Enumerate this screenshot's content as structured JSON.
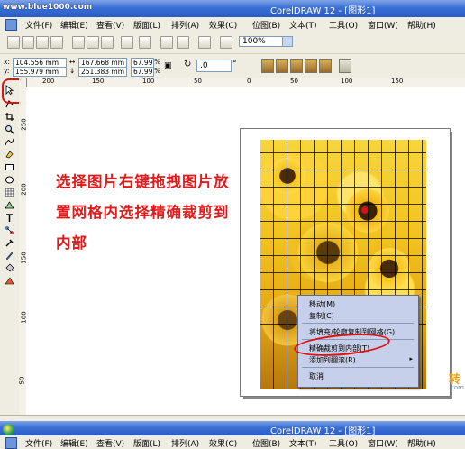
{
  "app": {
    "watermark": "www.blue1000.com",
    "title": "CorelDRAW 12 - [图形1]"
  },
  "menu": [
    "文件(F)",
    "编辑(E)",
    "查看(V)",
    "版面(L)",
    "排列(A)",
    "效果(C)",
    "位图(B)",
    "文本(T)",
    "工具(O)",
    "窗口(W)",
    "帮助(H)"
  ],
  "toolbar": {
    "zoom": "100%",
    "icons": [
      "new-icon",
      "open-icon",
      "save-icon",
      "print-icon",
      "cut-icon",
      "copy-icon",
      "paste-icon",
      "undo-icon",
      "redo-icon",
      "import-icon",
      "export-icon",
      "application-launcher-icon",
      "corel-online-icon"
    ]
  },
  "properties": {
    "x": "104.556 mm",
    "y": "155.979 mm",
    "width": "167.668 mm",
    "height": "251.383 mm",
    "scale_w": "67.99",
    "scale_h": "67.99",
    "percent": "%",
    "rotation": ".0",
    "degree": "°"
  },
  "rulers": {
    "h_labels": [
      "200",
      "150",
      "100",
      "50",
      "0",
      "50",
      "100",
      "150"
    ],
    "v_labels": [
      "250",
      "200",
      "150",
      "100",
      "50"
    ]
  },
  "instruction": {
    "line1": "选择图片右键拖拽图片放",
    "line2": "置网格内选择精确裁剪到",
    "line3": "内部"
  },
  "context_menu": {
    "items": [
      {
        "label": "移动(M)"
      },
      {
        "label": "复制(C)"
      },
      {
        "label": "将填充/轮廓复制到网格(G)"
      },
      {
        "label": "精确裁剪到内部(T)"
      },
      {
        "label": "添加到翻滚(R)"
      },
      {
        "label": "取消"
      }
    ],
    "submenu_arrow": "▸"
  },
  "logo": {
    "line1": "转",
    "line2": "com"
  },
  "colors": {
    "title_blue": "#3a6fd6",
    "menu_bg": "#efede2",
    "annotation_red": "#e01010",
    "context_menu_bg": "#c7d0ea",
    "sunflower_yellow": "#f2c21e"
  }
}
